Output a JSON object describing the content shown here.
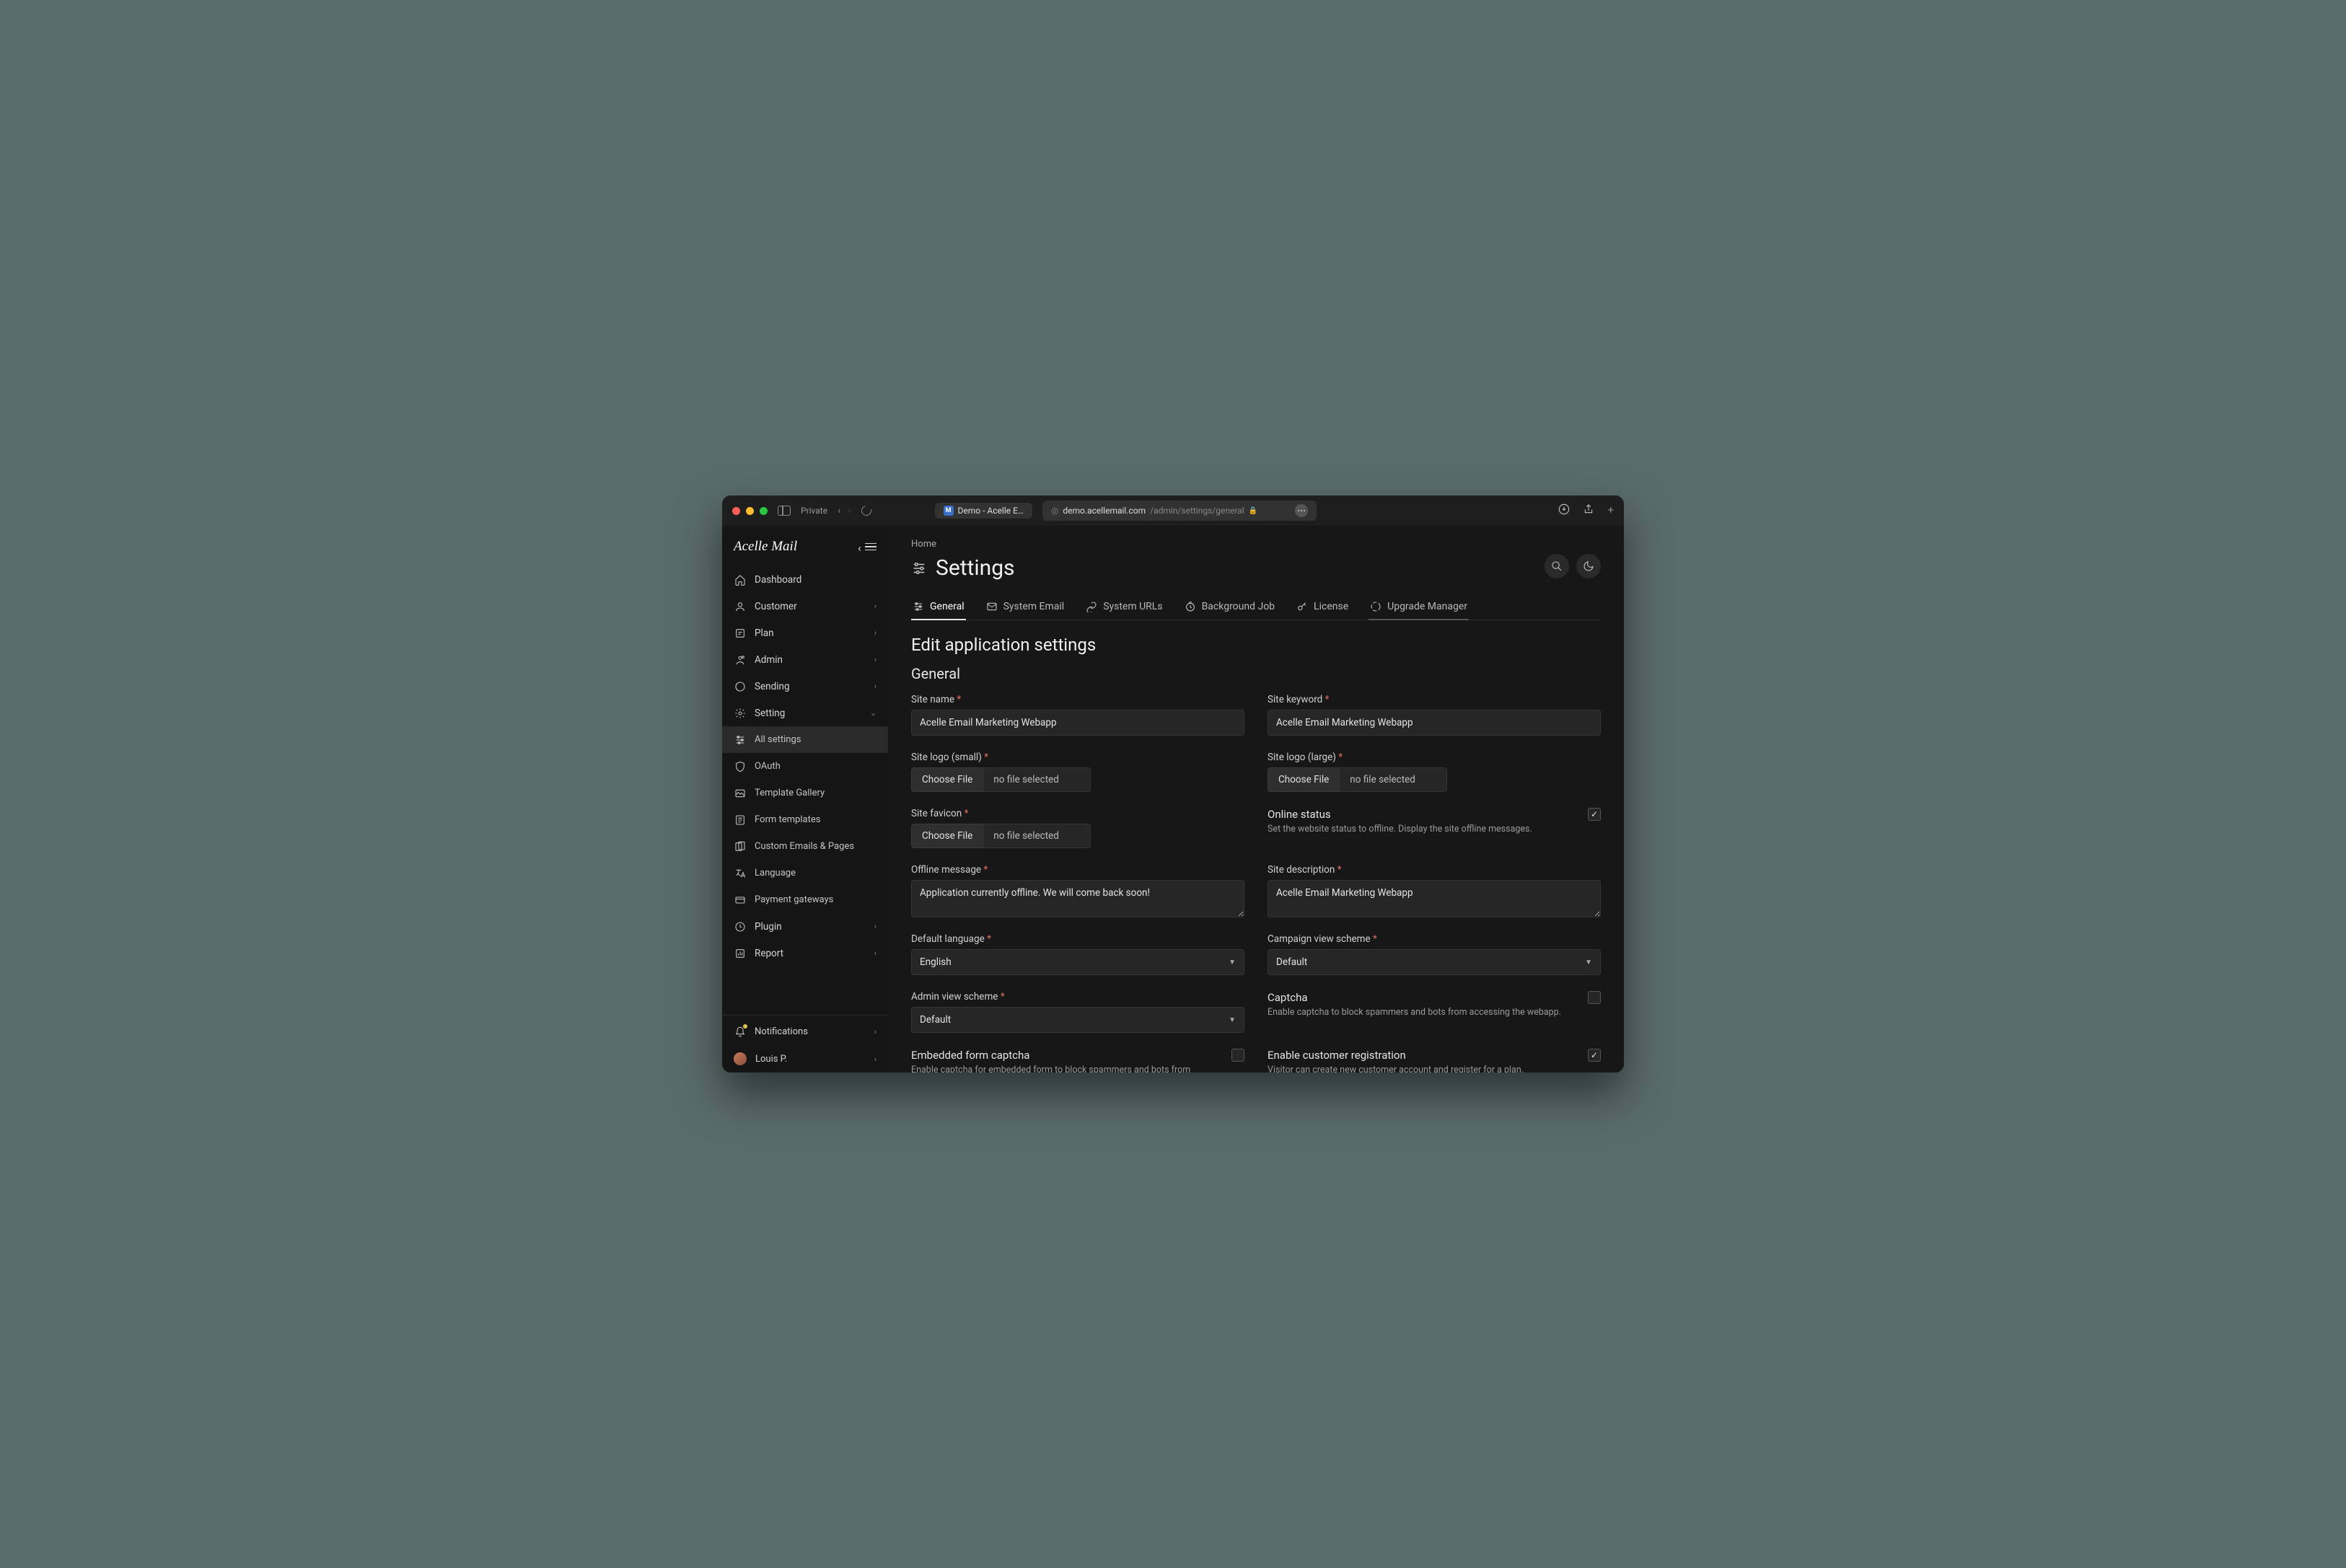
{
  "browser": {
    "private_label": "Private",
    "tab_title": "Demo - Acelle E…",
    "url_host": "demo.acellemail.com",
    "url_path": "/admin/settings/general"
  },
  "sidebar": {
    "logo": "Acelle Mail",
    "items": [
      {
        "icon": "home",
        "label": "Dashboard",
        "chev": false
      },
      {
        "icon": "user",
        "label": "Customer",
        "chev": true
      },
      {
        "icon": "plan",
        "label": "Plan",
        "chev": true
      },
      {
        "icon": "admin",
        "label": "Admin",
        "chev": true
      },
      {
        "icon": "sending",
        "label": "Sending",
        "chev": true
      },
      {
        "icon": "gear",
        "label": "Setting",
        "chev": true,
        "open": true
      },
      {
        "icon": "sliders",
        "label": "All settings",
        "sub": true,
        "highlight": true
      },
      {
        "icon": "shield",
        "label": "OAuth",
        "sub": true
      },
      {
        "icon": "gallery",
        "label": "Template Gallery",
        "sub": true
      },
      {
        "icon": "form",
        "label": "Form templates",
        "sub": true
      },
      {
        "icon": "pages",
        "label": "Custom Emails & Pages",
        "sub": true
      },
      {
        "icon": "lang",
        "label": "Language",
        "sub": true
      },
      {
        "icon": "card",
        "label": "Payment gateways",
        "sub": true
      },
      {
        "icon": "plugin",
        "label": "Plugin",
        "chev": true
      },
      {
        "icon": "report",
        "label": "Report",
        "chev": true
      }
    ],
    "footer": [
      {
        "icon": "bell",
        "label": "Notifications",
        "chev": true,
        "badge": true
      },
      {
        "icon": "avatar",
        "label": "Louis P.",
        "chev": true
      }
    ]
  },
  "main": {
    "breadcrumb": "Home",
    "title": "Settings",
    "tabs": [
      {
        "icon": "sliders",
        "label": "General",
        "active": true
      },
      {
        "icon": "mail",
        "label": "System Email"
      },
      {
        "icon": "link",
        "label": "System URLs"
      },
      {
        "icon": "clock",
        "label": "Background Job"
      },
      {
        "icon": "key",
        "label": "License"
      },
      {
        "icon": "spinner",
        "label": "Upgrade Manager",
        "upg": true
      }
    ],
    "heading": "Edit application settings",
    "section": "General",
    "fields": {
      "site_name": {
        "label": "Site name",
        "value": "Acelle Email Marketing Webapp"
      },
      "site_keyword": {
        "label": "Site keyword",
        "value": "Acelle Email Marketing Webapp"
      },
      "site_logo_small": {
        "label": "Site logo (small)",
        "btn": "Choose File",
        "status": "no file selected"
      },
      "site_logo_large": {
        "label": "Site logo (large)",
        "btn": "Choose File",
        "status": "no file selected"
      },
      "site_favicon": {
        "label": "Site favicon",
        "btn": "Choose File",
        "status": "no file selected"
      },
      "online_status": {
        "title": "Online status",
        "desc": "Set the website status to offline. Display the site offline messages.",
        "checked": true
      },
      "offline_message": {
        "label": "Offline message",
        "value": "Application currently offline. We will come back soon!"
      },
      "site_description": {
        "label": "Site description",
        "value": "Acelle Email Marketing Webapp"
      },
      "default_language": {
        "label": "Default language",
        "value": "English"
      },
      "campaign_view_scheme": {
        "label": "Campaign view scheme",
        "value": "Default"
      },
      "admin_view_scheme": {
        "label": "Admin view scheme",
        "value": "Default"
      },
      "captcha": {
        "title": "Captcha",
        "desc": "Enable captcha to block spammers and bots from accessing the webapp.",
        "checked": false
      },
      "embedded_captcha": {
        "title": "Embedded form captcha",
        "desc": "Enable captcha for embedded form to block spammers and bots from",
        "checked": false
      },
      "enable_registration": {
        "title": "Enable customer registration",
        "desc": "Visitor can create new customer account and register for a plan.",
        "checked": true
      }
    }
  }
}
